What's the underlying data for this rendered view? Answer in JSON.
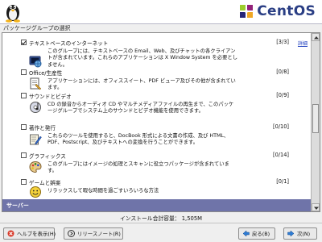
{
  "brand": {
    "name": "CentOS",
    "accent": "#2a3e84"
  },
  "section": {
    "title": "パッケージグループの選択"
  },
  "groups": [
    {
      "checked": true,
      "name": "テキストベースのインターネット",
      "count": "[3/3]",
      "detail": "詳細",
      "icon": "terminal-globe-icon",
      "description": "このグループには、テキストベースの Email、Web、及びチャットの各クライアントが含まれています。これらのアプリケーションは X Window System を必要としません。"
    },
    {
      "checked": false,
      "name": "Office/生産性",
      "count": "[0/8]",
      "icon": "office-document-icon",
      "description": "アプリケーションには、オフィススイート、PDF ビューア及びその他が含まれています。"
    },
    {
      "checked": false,
      "name": "サウンドとビデオ",
      "count": "[0/9]",
      "icon": "sound-video-icon",
      "description": "CD の録音からオーディオ CD やマルチメディアファイルの再生まで、このパッケージグループでシステム上のサウンドとビデオ機能を使用できます。"
    },
    {
      "checked": false,
      "name": "著作と発行",
      "count": "[0/10]",
      "icon": "authoring-pen-icon",
      "description": "これらのツールを使用すると、DocBook 形式による文書の作成、及び HTML、PDF、Postscript、及びテキストへの変換を行うことができます。"
    },
    {
      "checked": false,
      "name": "グラフィックス",
      "count": "[0/14]",
      "icon": "graphics-palette-icon",
      "description": "このグループにはイメージの処理とスキャンに役立つパッケージが含まれています。"
    },
    {
      "checked": false,
      "name": "ゲームと娯楽",
      "count": "[0/1]",
      "icon": "games-face-icon",
      "description": "リラックスして暇な時間を過ごすいろいろな方法"
    }
  ],
  "category": {
    "label": "サーバー"
  },
  "install_size": "インストール合計容量： 1,505M",
  "buttons": {
    "help": "ヘルプを表示(H)",
    "release_notes": "リリースノート(R)",
    "back": "戻る(B)",
    "next": "次(N)"
  }
}
